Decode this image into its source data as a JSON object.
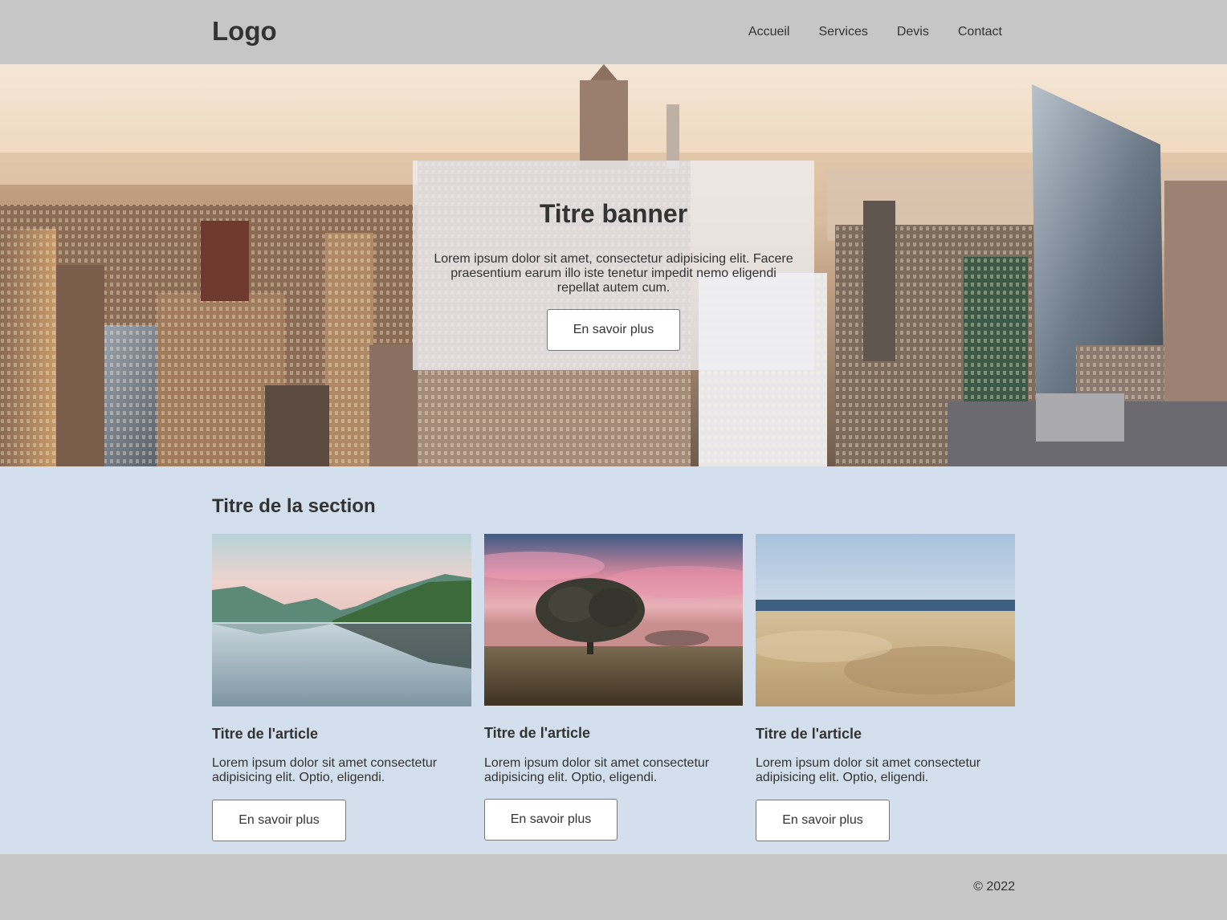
{
  "header": {
    "logo": "Logo",
    "nav": [
      "Accueil",
      "Services",
      "Devis",
      "Contact"
    ]
  },
  "banner": {
    "title": "Titre banner",
    "text": "Lorem ipsum dolor sit amet, consectetur adipisicing elit. Facere praesentium earum illo iste tenetur impedit nemo eligendi repellat autem cum.",
    "button": "En savoir plus",
    "image": "city-skyline-image"
  },
  "section": {
    "title": "Titre de la section",
    "articles": [
      {
        "title": "Titre de l'article",
        "text": "Lorem ipsum dolor sit amet consectetur adipisicing elit. Optio, eligendi.",
        "button": "En savoir plus",
        "image": "lake-mountains-image"
      },
      {
        "title": "Titre de l'article",
        "text": "Lorem ipsum dolor sit amet consectetur adipisicing elit. Optio, eligendi.",
        "button": "En savoir plus",
        "image": "tree-sunset-image"
      },
      {
        "title": "Titre de l'article",
        "text": "Lorem ipsum dolor sit amet consectetur adipisicing elit. Optio, eligendi.",
        "button": "En savoir plus",
        "image": "desert-sea-image"
      }
    ]
  },
  "footer": {
    "copyright": "© 2022"
  },
  "colors": {
    "header_bg": "#c6c6c6",
    "section_bg": "#d3dfec",
    "text": "#333333"
  }
}
